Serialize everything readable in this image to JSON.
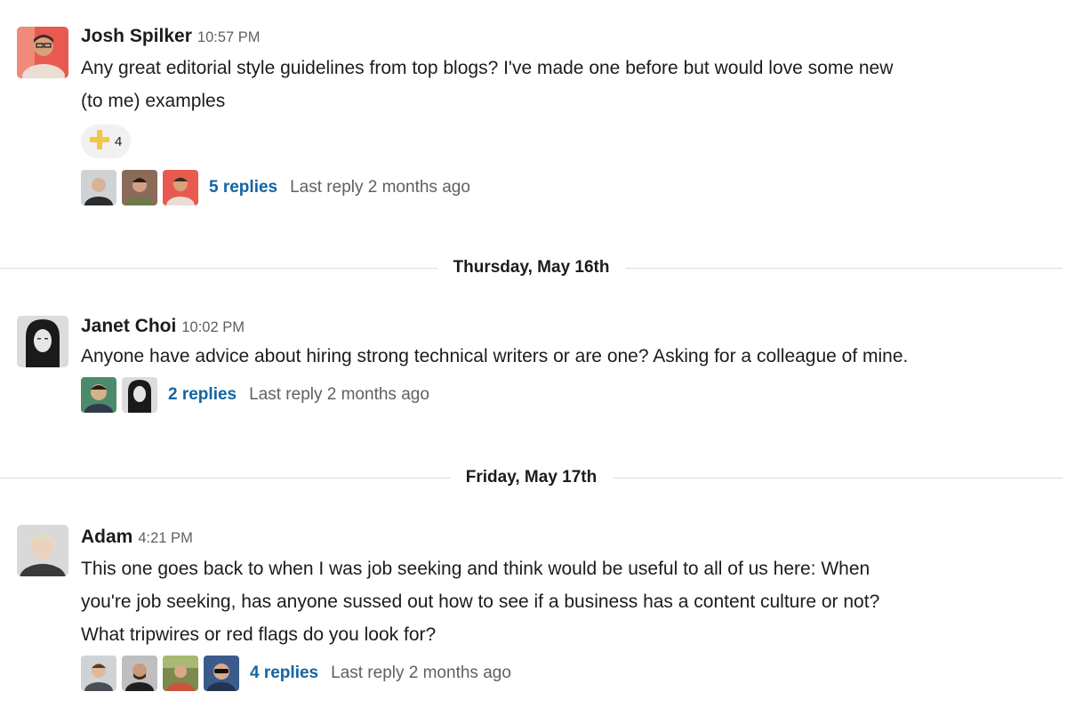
{
  "messages": [
    {
      "author": "Josh Spilker",
      "time": "10:57 PM",
      "text_lines": [
        "Any great editorial style guidelines from top blogs? I've made one before but would love some new",
        "(to me) examples"
      ],
      "reaction": {
        "emoji": "heavy-plus-sign-icon",
        "count": "4"
      },
      "thread": {
        "replies": "5 replies",
        "last_reply": "Last reply 2 months ago"
      }
    },
    {
      "author": "Janet Choi",
      "time": "10:02 PM",
      "text_lines": [
        "Anyone have advice about hiring strong technical writers or are one? Asking for a colleague of mine."
      ],
      "thread": {
        "replies": "2 replies",
        "last_reply": "Last reply 2 months ago"
      }
    },
    {
      "author": "Adam",
      "time": "4:21 PM",
      "text_lines": [
        "This one goes back to when I was job seeking and think would be useful to all of us here: When",
        "you're job seeking, has anyone sussed out how to see if a business has a content culture or not?",
        "What tripwires or red flags do you look for?"
      ],
      "thread": {
        "replies": "4 replies",
        "last_reply": "Last reply 2 months ago"
      }
    }
  ],
  "dividers": [
    "Thursday, May 16th",
    "Friday, May 17th"
  ],
  "colors": {
    "link": "#1264a3",
    "muted": "#616061",
    "reaction_bg": "#f1f1f1",
    "plus_emoji": "#f2c744",
    "divider_line": "#dddddd"
  }
}
